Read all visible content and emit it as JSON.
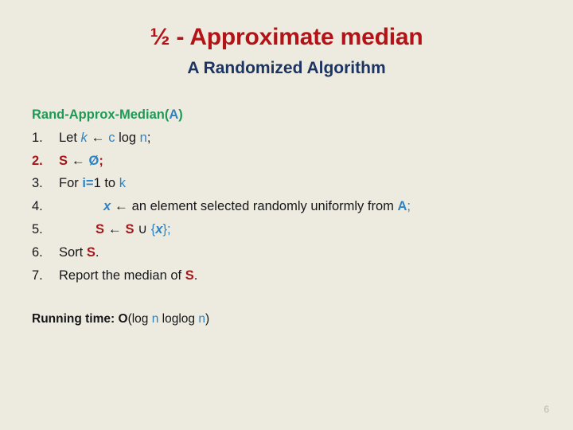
{
  "slide": {
    "background_color": "#EDEBDF",
    "title": "½ - Approximate median",
    "title_color": "#B31317",
    "subtitle": "A Randomized Algorithm",
    "subtitle_color": "#1C3461",
    "page_number": "6"
  },
  "algorithm": {
    "header": {
      "name": "Rand-Approx-Median",
      "open_paren": "(",
      "arg": "A",
      "close_paren": ")"
    },
    "lines": [
      {
        "number": "1.",
        "tokens": [
          {
            "t": "Let ",
            "c": "blk"
          },
          {
            "t": "k",
            "c": "blue-i"
          },
          {
            "t": " ← ",
            "c": "arrow"
          },
          {
            "t": "c",
            "c": "blue"
          },
          {
            "t": " log ",
            "c": "blk"
          },
          {
            "t": "n",
            "c": "blue"
          },
          {
            "t": ";",
            "c": "blk"
          }
        ]
      },
      {
        "number": "2.",
        "tokens": [
          {
            "t": "S",
            "c": "red-b"
          },
          {
            "t": " ← ",
            "c": "arrow"
          },
          {
            "t": "Ø",
            "c": "blue-b"
          },
          {
            "t": ";",
            "c": "red-b"
          }
        ]
      },
      {
        "number": "3.",
        "tokens": [
          {
            "t": "For ",
            "c": "blk"
          },
          {
            "t": "i=",
            "c": "blue-b"
          },
          {
            "t": "1",
            "c": "blk"
          },
          {
            "t": " to ",
            "c": "blk"
          },
          {
            "t": "k",
            "c": "blue"
          }
        ]
      },
      {
        "number": "4.",
        "tokens": [
          {
            "t": "x",
            "c": "blue-bi"
          },
          {
            "t": " ← ",
            "c": "arrow"
          },
          {
            "t": "an element selected randomly uniformly from ",
            "c": "blk"
          },
          {
            "t": "A",
            "c": "blue-b"
          },
          {
            "t": ";",
            "c": "blue"
          }
        ]
      },
      {
        "number": "5.",
        "tokens": [
          {
            "t": "S",
            "c": "red-b"
          },
          {
            "t": " ← ",
            "c": "arrow"
          },
          {
            "t": "S",
            "c": "red-b"
          },
          {
            "t": " ∪ ",
            "c": "blk"
          },
          {
            "t": "{",
            "c": "blue"
          },
          {
            "t": "x",
            "c": "blue-bi"
          },
          {
            "t": "}",
            "c": "blue"
          },
          {
            "t": ";",
            "c": "blue"
          }
        ]
      },
      {
        "number": "6.",
        "tokens": [
          {
            "t": "Sort ",
            "c": "blk"
          },
          {
            "t": "S",
            "c": "red-b"
          },
          {
            "t": ".",
            "c": "blk"
          }
        ]
      },
      {
        "number": "7.",
        "tokens": [
          {
            "t": "Report the median of ",
            "c": "blk"
          },
          {
            "t": "S",
            "c": "red-b"
          },
          {
            "t": ".",
            "c": "blk"
          }
        ]
      }
    ]
  },
  "running_time": {
    "label": "Running time: ",
    "big_o": "O",
    "open": "(log ",
    "n1": "n",
    "mid": " loglog ",
    "n2": "n",
    "close": ")"
  }
}
